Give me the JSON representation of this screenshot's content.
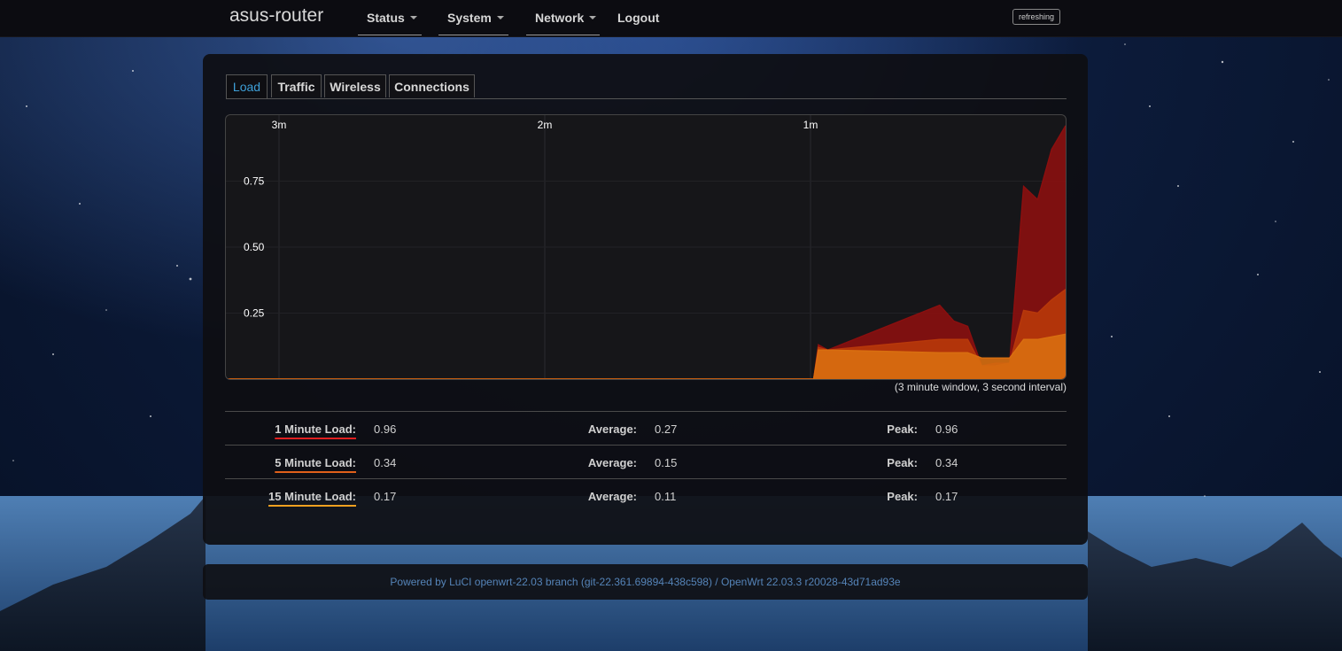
{
  "brand": "asus-router",
  "nav": {
    "status": "Status",
    "system": "System",
    "network": "Network",
    "logout": "Logout"
  },
  "refresh_label": "refreshing",
  "tabs": [
    "Load",
    "Traffic",
    "Wireless",
    "Connections"
  ],
  "active_tab": "Load",
  "chart_data": {
    "type": "area",
    "x_ticks": [
      "3m",
      "2m",
      "1m"
    ],
    "y_ticks": [
      "0.75",
      "0.50",
      "0.25"
    ],
    "ylim": [
      0,
      1
    ],
    "x_unit": "seconds",
    "series": [
      {
        "color": "#8a0f0f",
        "x": [
          0,
          126,
          127,
          129,
          153,
          156,
          159,
          162,
          165,
          168,
          171,
          174,
          177,
          180
        ],
        "values": [
          0,
          0,
          0.13,
          0.11,
          0.28,
          0.22,
          0.2,
          0.05,
          0.06,
          0.06,
          0.73,
          0.68,
          0.87,
          0.96
        ]
      },
      {
        "color": "#b8380a",
        "x": [
          0,
          126,
          127,
          129,
          153,
          156,
          159,
          162,
          165,
          168,
          171,
          174,
          177,
          180
        ],
        "values": [
          0,
          0,
          0.12,
          0.11,
          0.15,
          0.15,
          0.15,
          0.05,
          0.05,
          0.06,
          0.26,
          0.25,
          0.3,
          0.34
        ]
      },
      {
        "color": "#d86e10",
        "x": [
          0,
          126,
          127,
          129,
          153,
          156,
          159,
          162,
          165,
          168,
          171,
          174,
          177,
          180
        ],
        "values": [
          0,
          0,
          0.11,
          0.11,
          0.1,
          0.1,
          0.1,
          0.08,
          0.08,
          0.08,
          0.15,
          0.15,
          0.16,
          0.17
        ]
      }
    ]
  },
  "caption": "(3 minute window, 3 second interval)",
  "stats": [
    {
      "label": "1 Minute Load:",
      "value": "0.96",
      "avg_label": "Average:",
      "avg": "0.27",
      "peak_label": "Peak:",
      "peak": "0.96",
      "color": "#e02020"
    },
    {
      "label": "5 Minute Load:",
      "value": "0.34",
      "avg_label": "Average:",
      "avg": "0.15",
      "peak_label": "Peak:",
      "peak": "0.34",
      "color": "#e0601a"
    },
    {
      "label": "15 Minute Load:",
      "value": "0.17",
      "avg_label": "Average:",
      "avg": "0.11",
      "peak_label": "Peak:",
      "peak": "0.17",
      "color": "#f0a020"
    }
  ],
  "footer": "Powered by LuCI openwrt-22.03 branch (git-22.361.69894-438c598) / OpenWrt 22.03.3 r20028-43d71ad93e"
}
